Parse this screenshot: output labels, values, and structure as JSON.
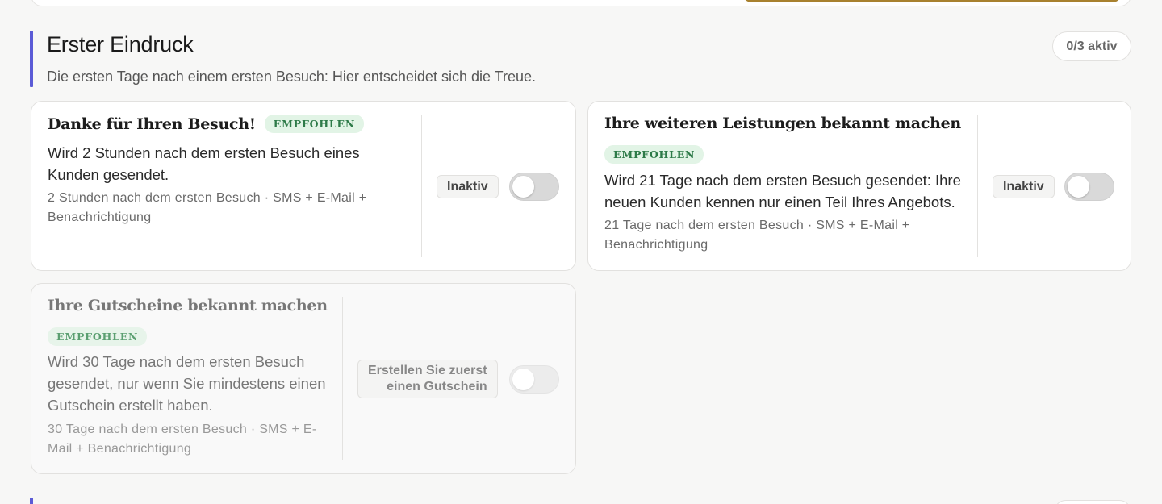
{
  "section": {
    "title": "Erster Eindruck",
    "subtitle": "Die ersten Tage nach einem ersten Besuch: Hier entscheidet sich die Treue.",
    "active_count": "0/3 aktiv"
  },
  "cards": [
    {
      "title": "Danke für Ihren Besuch!",
      "badge": "EMPFOHLEN",
      "description_lines": [
        "Wird 2 Stunden nach dem ersten Besuch eines",
        "Kunden gesendet."
      ],
      "meta_lines": [
        "2 Stunden nach dem ersten Besuch · SMS + E-Mail +",
        "Benachrichtigung"
      ],
      "status": "Inaktiv",
      "enabled": false
    },
    {
      "title": "Ihre weiteren Leistungen bekannt machen",
      "badge": "EMPFOHLEN",
      "description_lines": [
        "Wird 21 Tage nach dem ersten Besuch gesendet: Ihre",
        "neuen Kunden kennen nur einen Teil Ihres Angebots."
      ],
      "meta_lines": [
        "21 Tage nach dem ersten Besuch · SMS + E-Mail +",
        "Benachrichtigung"
      ],
      "status": "Inaktiv",
      "enabled": false
    },
    {
      "title": "Ihre Gutscheine bekannt machen",
      "badge": "EMPFOHLEN",
      "description_lines": [
        "Wird 30 Tage nach dem ersten Besuch",
        "gesendet, nur wenn Sie mindestens einen",
        "Gutschein erstellt haben."
      ],
      "meta_lines": [
        "30 Tage nach dem ersten Besuch · SMS + E-",
        "Mail + Benachrichtigung"
      ],
      "status_lines": [
        "Erstellen Sie zuerst",
        "einen Gutschein"
      ],
      "enabled": false
    }
  ],
  "colors": {
    "accent": "#5b5bd6",
    "badge_text": "#2d7a48",
    "badge_bg": "#e2f4e6",
    "gold": "#a8812f"
  }
}
